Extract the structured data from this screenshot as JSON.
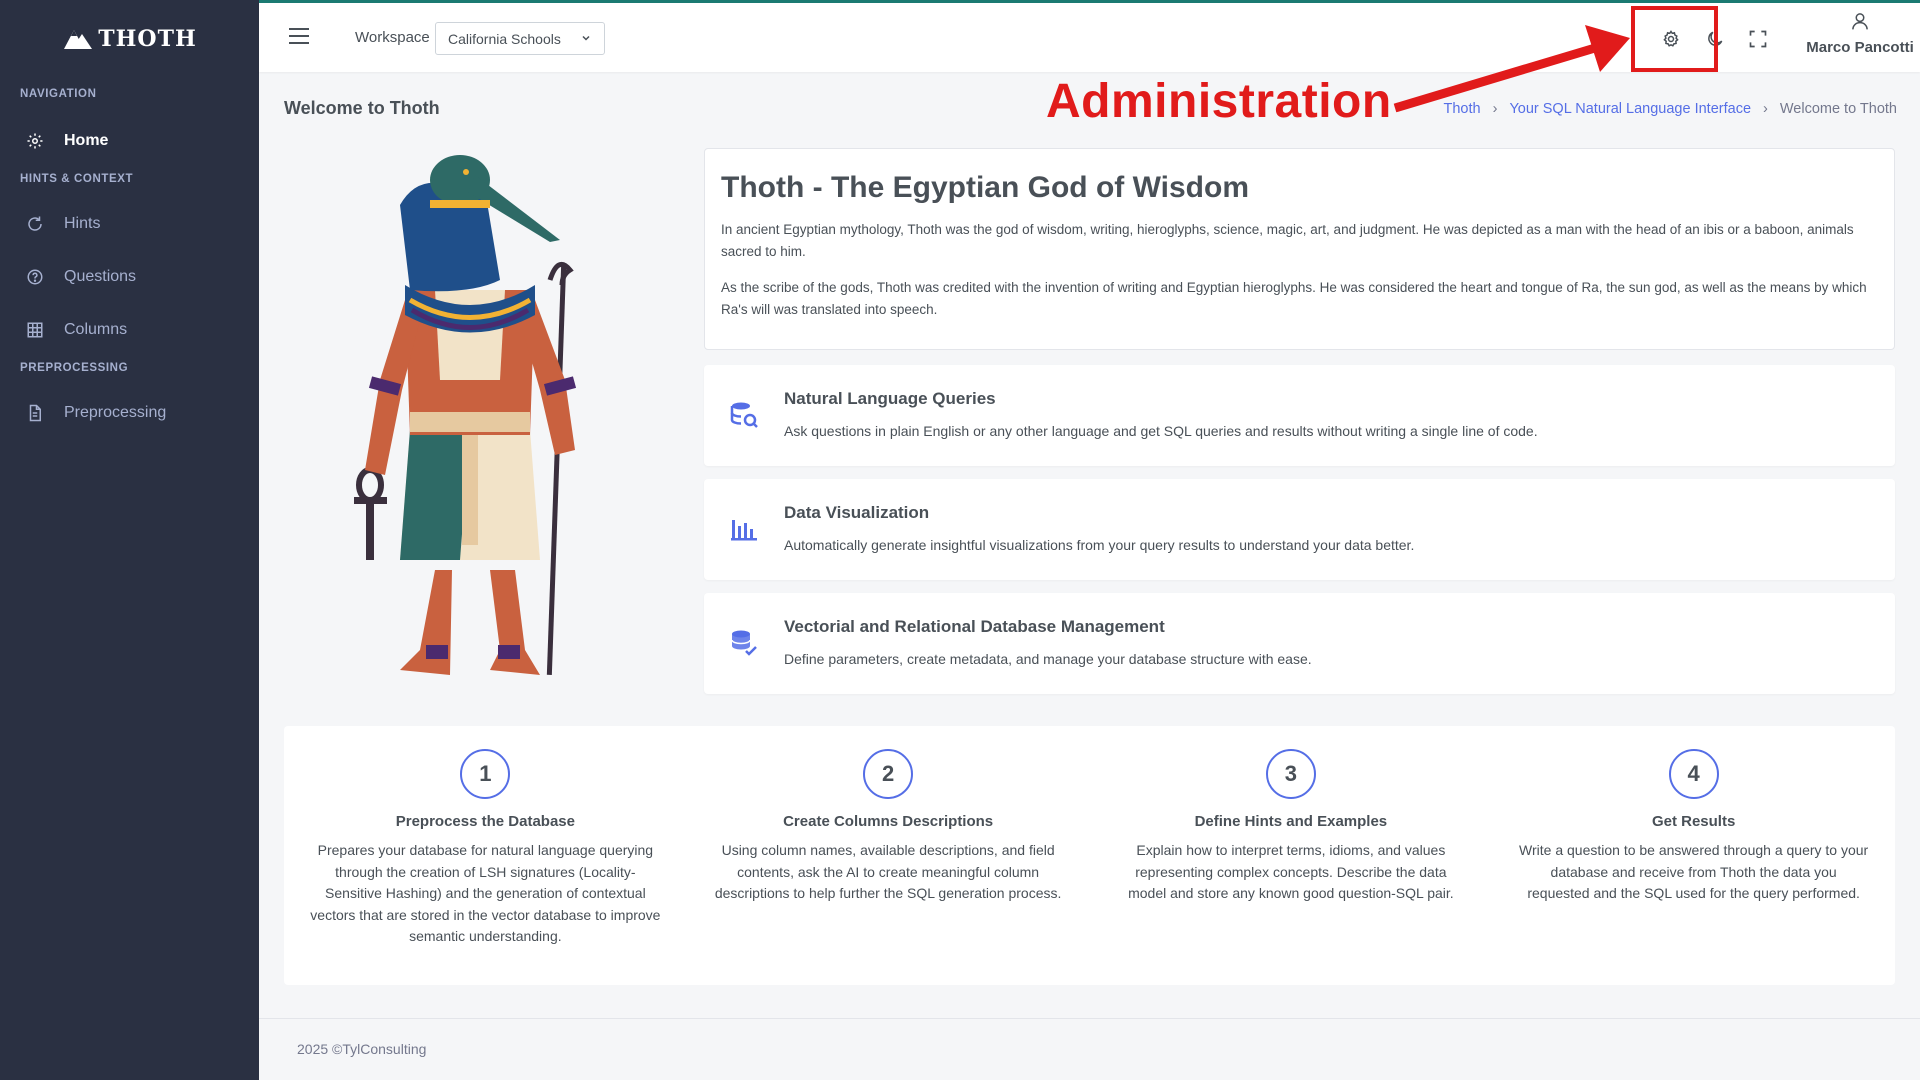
{
  "brand": {
    "name": "THOTH"
  },
  "sidebar": {
    "sections": [
      {
        "title": "NAVIGATION",
        "items": [
          {
            "label": "Home",
            "icon": "gear-icon",
            "active": true
          }
        ]
      },
      {
        "title": "HINTS & CONTEXT",
        "items": [
          {
            "label": "Hints",
            "icon": "refresh-icon"
          },
          {
            "label": "Questions",
            "icon": "help-circle-icon"
          },
          {
            "label": "Columns",
            "icon": "grid-icon"
          }
        ]
      },
      {
        "title": "PREPROCESSING",
        "items": [
          {
            "label": "Preprocessing",
            "icon": "file-icon"
          }
        ]
      }
    ]
  },
  "topbar": {
    "workspace_label": "Workspace",
    "workspace_value": "California Schools",
    "user_name": "Marco Pancotti"
  },
  "annotation": {
    "label": "Administration",
    "color": "#e11b1b"
  },
  "page": {
    "title": "Welcome to Thoth",
    "breadcrumb": [
      "Thoth",
      "Your SQL Natural Language Interface",
      "Welcome to Thoth"
    ]
  },
  "intro": {
    "heading": "Thoth - The Egyptian God of Wisdom",
    "p1": "In ancient Egyptian mythology, Thoth was the god of wisdom, writing, hieroglyphs, science, magic, art, and judgment. He was depicted as a man with the head of an ibis or a baboon, animals sacred to him.",
    "p2": "As the scribe of the gods, Thoth was credited with the invention of writing and Egyptian hieroglyphs. He was considered the heart and tongue of Ra, the sun god, as well as the means by which Ra's will was translated into speech."
  },
  "features": [
    {
      "title": "Natural Language Queries",
      "text": "Ask questions in plain English or any other language and get SQL queries and results without writing a single line of code.",
      "icon": "database-search-icon"
    },
    {
      "title": "Data Visualization",
      "text": "Automatically generate insightful visualizations from your query results to understand your data better.",
      "icon": "bar-chart-icon"
    },
    {
      "title": "Vectorial and Relational Database Management",
      "text": "Define parameters, create metadata, and manage your database structure with ease.",
      "icon": "database-check-icon"
    }
  ],
  "steps": [
    {
      "num": "1",
      "title": "Preprocess the Database",
      "text": "Prepares your database for natural language querying through the creation of LSH signatures (Locality-Sensitive Hashing) and the generation of contextual vectors that are stored in the vector database to improve semantic understanding."
    },
    {
      "num": "2",
      "title": "Create Columns Descriptions",
      "text": "Using column names, available descriptions, and field contents, ask the AI to create meaningful column descriptions to help further the SQL generation process."
    },
    {
      "num": "3",
      "title": "Define Hints and Examples",
      "text": "Explain how to interpret terms, idioms, and values representing complex concepts. Describe the data model and store any known good question-SQL pair."
    },
    {
      "num": "4",
      "title": "Get Results",
      "text": "Write a question to be answered through a query to your database and receive from Thoth the data you requested and the SQL used for the query performed."
    }
  ],
  "footer": {
    "text": "2025 ©TylConsulting"
  },
  "colors": {
    "sidebar_bg": "#2a3042",
    "accent": "#556ee6",
    "annotation": "#e11b1b"
  }
}
